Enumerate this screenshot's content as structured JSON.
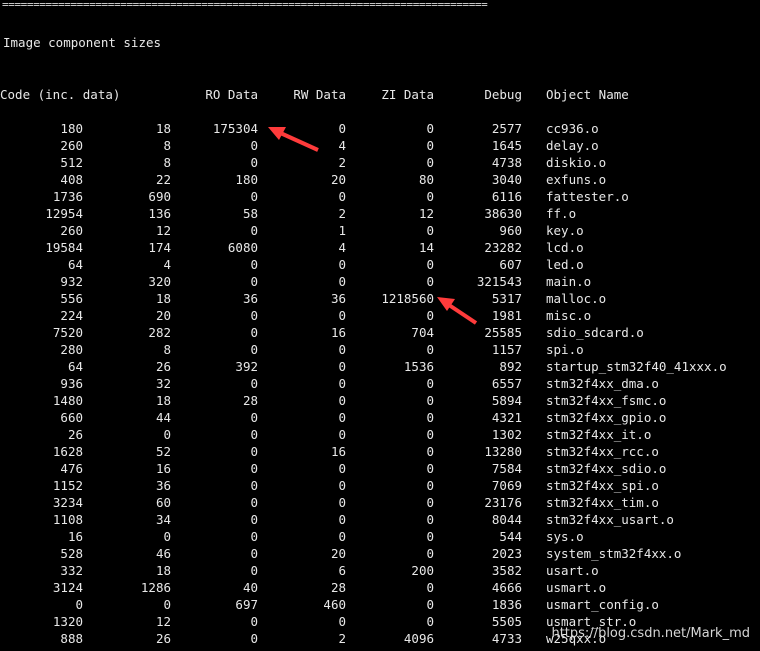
{
  "separator": "==============================================================================",
  "heading": "Image component sizes",
  "columns": [
    "Code (inc. data)",
    "",
    "RO Data",
    "RW Data",
    "ZI Data",
    "Debug",
    "Object Name"
  ],
  "rows": [
    [
      "180",
      "18",
      "175304",
      "0",
      "0",
      "2577",
      "cc936.o"
    ],
    [
      "260",
      "8",
      "0",
      "4",
      "0",
      "1645",
      "delay.o"
    ],
    [
      "512",
      "8",
      "0",
      "2",
      "0",
      "4738",
      "diskio.o"
    ],
    [
      "408",
      "22",
      "180",
      "20",
      "80",
      "3040",
      "exfuns.o"
    ],
    [
      "1736",
      "690",
      "0",
      "0",
      "0",
      "6116",
      "fattester.o"
    ],
    [
      "12954",
      "136",
      "58",
      "2",
      "12",
      "38630",
      "ff.o"
    ],
    [
      "260",
      "12",
      "0",
      "1",
      "0",
      "960",
      "key.o"
    ],
    [
      "19584",
      "174",
      "6080",
      "4",
      "14",
      "23282",
      "lcd.o"
    ],
    [
      "64",
      "4",
      "0",
      "0",
      "0",
      "607",
      "led.o"
    ],
    [
      "932",
      "320",
      "0",
      "0",
      "0",
      "321543",
      "main.o"
    ],
    [
      "556",
      "18",
      "36",
      "36",
      "1218560",
      "5317",
      "malloc.o"
    ],
    [
      "224",
      "20",
      "0",
      "0",
      "0",
      "1981",
      "misc.o"
    ],
    [
      "7520",
      "282",
      "0",
      "16",
      "704",
      "25585",
      "sdio_sdcard.o"
    ],
    [
      "280",
      "8",
      "0",
      "0",
      "0",
      "1157",
      "spi.o"
    ],
    [
      "64",
      "26",
      "392",
      "0",
      "1536",
      "892",
      "startup_stm32f40_41xxx.o"
    ],
    [
      "936",
      "32",
      "0",
      "0",
      "0",
      "6557",
      "stm32f4xx_dma.o"
    ],
    [
      "1480",
      "18",
      "28",
      "0",
      "0",
      "5894",
      "stm32f4xx_fsmc.o"
    ],
    [
      "660",
      "44",
      "0",
      "0",
      "0",
      "4321",
      "stm32f4xx_gpio.o"
    ],
    [
      "26",
      "0",
      "0",
      "0",
      "0",
      "1302",
      "stm32f4xx_it.o"
    ],
    [
      "1628",
      "52",
      "0",
      "16",
      "0",
      "13280",
      "stm32f4xx_rcc.o"
    ],
    [
      "476",
      "16",
      "0",
      "0",
      "0",
      "7584",
      "stm32f4xx_sdio.o"
    ],
    [
      "1152",
      "36",
      "0",
      "0",
      "0",
      "7069",
      "stm32f4xx_spi.o"
    ],
    [
      "3234",
      "60",
      "0",
      "0",
      "0",
      "23176",
      "stm32f4xx_tim.o"
    ],
    [
      "1108",
      "34",
      "0",
      "0",
      "0",
      "8044",
      "stm32f4xx_usart.o"
    ],
    [
      "16",
      "0",
      "0",
      "0",
      "0",
      "544",
      "sys.o"
    ],
    [
      "528",
      "46",
      "0",
      "20",
      "0",
      "2023",
      "system_stm32f4xx.o"
    ],
    [
      "332",
      "18",
      "0",
      "6",
      "200",
      "3582",
      "usart.o"
    ],
    [
      "3124",
      "1286",
      "40",
      "28",
      "0",
      "4666",
      "usmart.o"
    ],
    [
      "0",
      "0",
      "697",
      "460",
      "0",
      "1836",
      "usmart_config.o"
    ],
    [
      "1320",
      "12",
      "0",
      "0",
      "0",
      "5505",
      "usmart_str.o"
    ],
    [
      "888",
      "26",
      "0",
      "2",
      "4096",
      "4733",
      "w25qxx.o"
    ]
  ],
  "annotations": {
    "arrow_color": "#ff3b3b"
  },
  "watermark": "https://blog.csdn.net/Mark_md"
}
